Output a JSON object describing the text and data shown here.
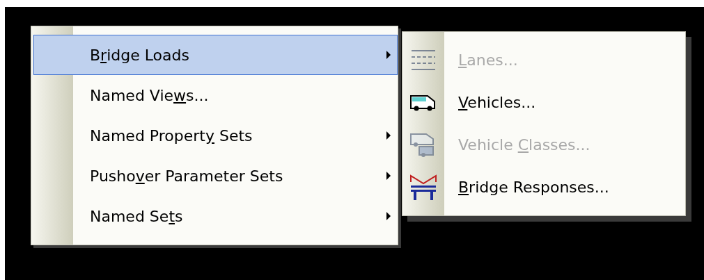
{
  "menu": {
    "items": [
      {
        "label_before": "B",
        "access_key": "r",
        "label_after": "idge Loads",
        "selected": true,
        "submenu": true
      },
      {
        "label_before": "Named Vie",
        "access_key": "w",
        "label_after": "s...",
        "selected": false,
        "submenu": false
      },
      {
        "label_before": "Named Propert",
        "access_key": "y",
        "label_after": " Sets",
        "selected": false,
        "submenu": true
      },
      {
        "label_before": "Pusho",
        "access_key": "v",
        "label_after": "er Parameter Sets",
        "selected": false,
        "submenu": true
      },
      {
        "label_before": "Named Se",
        "access_key": "t",
        "label_after": "s",
        "selected": false,
        "submenu": true
      }
    ]
  },
  "submenu": {
    "items": [
      {
        "kind": "lanes",
        "access_key": "L",
        "label_after": "anes...",
        "disabled": true
      },
      {
        "kind": "vehicle",
        "access_key": "V",
        "label_after": "ehicles...",
        "disabled": false
      },
      {
        "kind": "vehicle-classes",
        "label_before": "Vehicle ",
        "access_key": "C",
        "label_after": "lasses...",
        "disabled": true
      },
      {
        "kind": "bridge",
        "access_key": "B",
        "label_after": "ridge Responses...",
        "disabled": false
      }
    ]
  }
}
